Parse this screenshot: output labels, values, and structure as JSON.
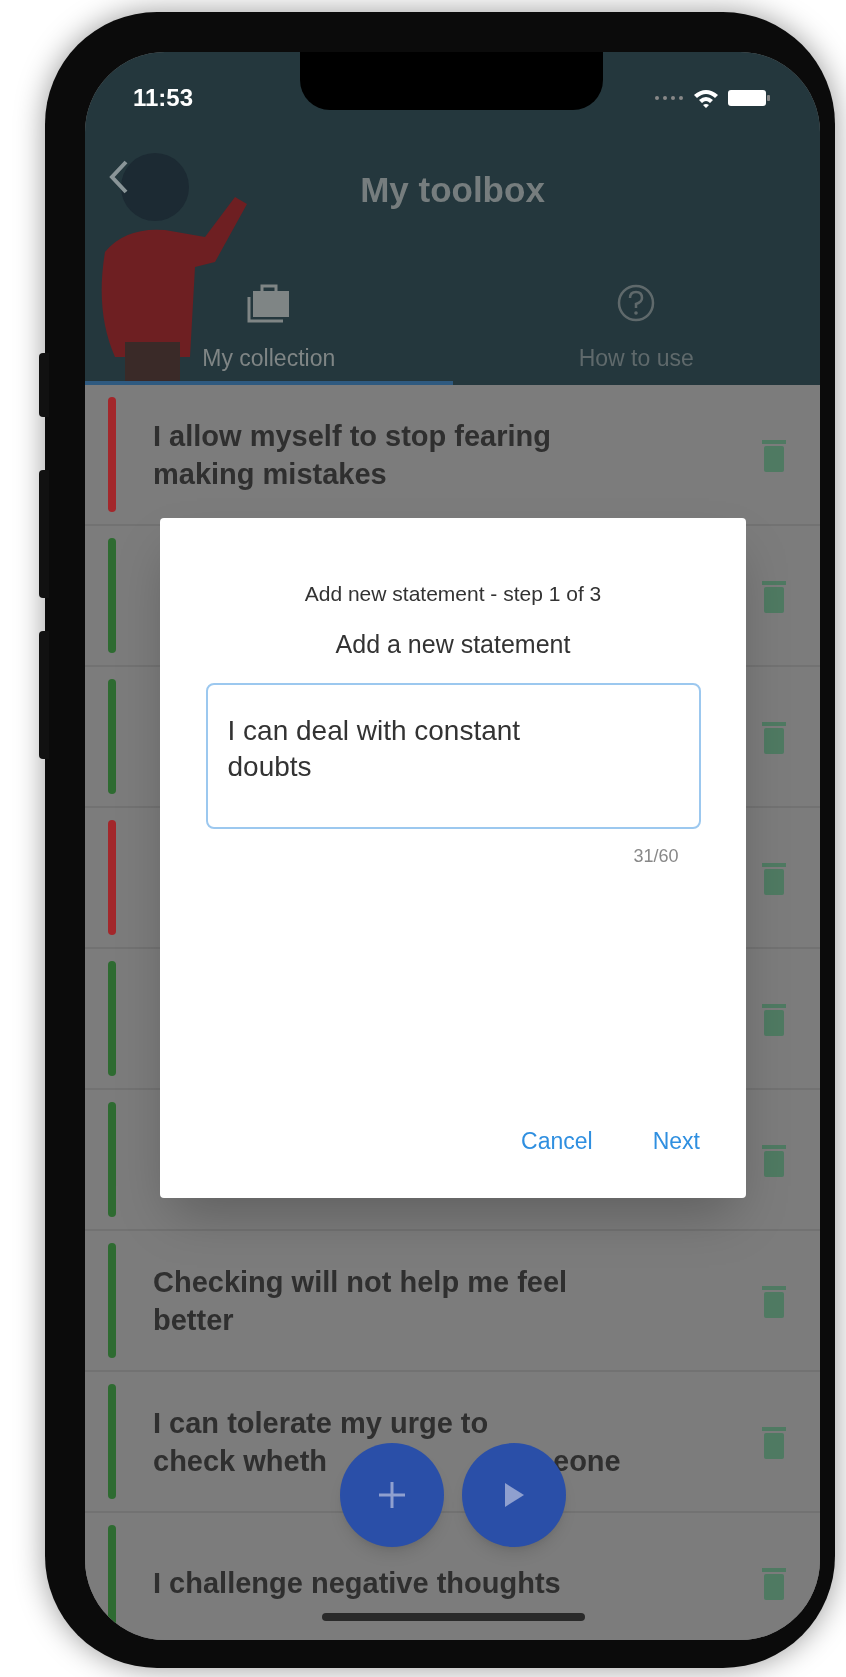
{
  "status_bar": {
    "time": "11:53"
  },
  "header": {
    "title": "My toolbox"
  },
  "tabs": [
    {
      "label": "My collection",
      "selected": true
    },
    {
      "label": "How to use",
      "selected": false
    }
  ],
  "rows": [
    {
      "text": "I allow myself to stop fearing making mistakes",
      "color": "#a3272b"
    },
    {
      "color": "#2e6b31"
    },
    {
      "color": "#2e6b31"
    },
    {
      "color": "#a3272b"
    },
    {
      "color": "#2e6b31"
    },
    {
      "color": "#2e6b31"
    },
    {
      "text": "Checking will not help me feel better",
      "color": "#2e6b31"
    },
    {
      "lines": [
        [
          "I can tolerate my urge to"
        ],
        [
          "check wheth",
          "eone"
        ]
      ],
      "color": "#2e6b31"
    },
    {
      "text": "I challenge negative thoughts",
      "color": "#2e6b31"
    }
  ],
  "dialog": {
    "step": "Add new statement - step 1 of 3",
    "title": "Add a new statement",
    "value": "I can deal with constant doubts",
    "counter": "31/60",
    "buttons": [
      "Cancel",
      "Next"
    ]
  }
}
